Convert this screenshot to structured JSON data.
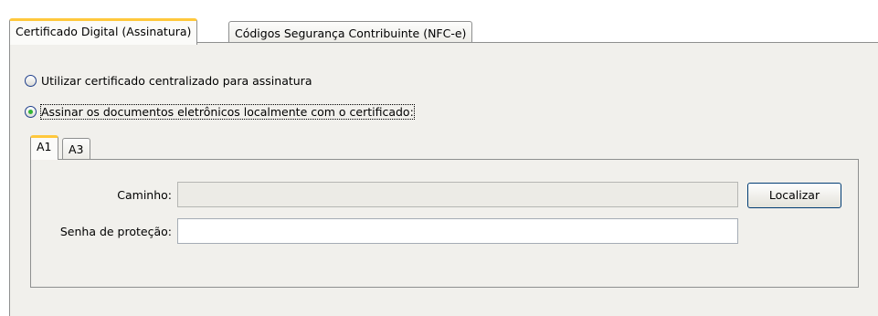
{
  "outer_tabs": [
    {
      "label": "Certificado Digital (Assinatura)",
      "active": true
    },
    {
      "label": "Códigos Segurança Contribuinte (NFC-e)",
      "active": false
    }
  ],
  "signing_options": [
    {
      "label": "Utilizar certificado centralizado para assinatura",
      "checked": false
    },
    {
      "label": "Assinar os documentos eletrônicos localmente com o certificado:",
      "checked": true
    }
  ],
  "cert_tabs": [
    {
      "label": "A1",
      "active": true
    },
    {
      "label": "A3",
      "active": false
    }
  ],
  "form": {
    "path_label": "Caminho:",
    "path_value": "",
    "password_label": "Senha de proteção:",
    "password_value": "",
    "locate_button": "Localizar"
  },
  "colors": {
    "tab_accent": "#ffc83c",
    "radio_dot": "#33b535",
    "panel_bg": "#f1f0ec"
  }
}
